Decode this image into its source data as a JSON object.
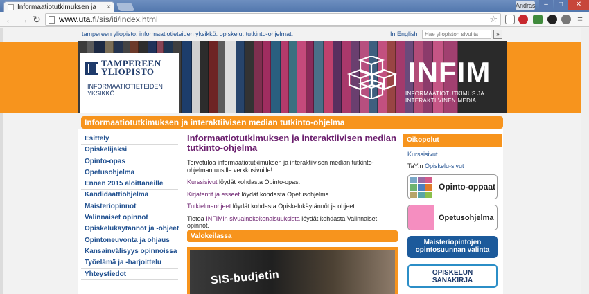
{
  "browser": {
    "tab_title": "Informaatiotutkimuksen ja",
    "tab_close": "×",
    "user_badge": "Andras",
    "win_min": "–",
    "win_max": "□",
    "win_close": "✕",
    "back": "←",
    "forward": "→",
    "reload": "↻",
    "url_host": "www.uta.fi",
    "url_path": "/sis/iti/index.html",
    "star": "☆",
    "menu": "≡"
  },
  "top": {
    "breadcrumb": "tampereen yliopisto: informaatiotieteiden yksikkö: opiskelu: tutkinto-ohjelmat:",
    "language": "In English",
    "search_placeholder": "Hae yliopiston sivuilta",
    "search_go": "»"
  },
  "banner": {
    "uni_name_1": "TAMPEREEN",
    "uni_name_2": "YLIOPISTO",
    "unit_1": "INFORMAATIOTIETEIDEN",
    "unit_2": "YKSIKKÖ",
    "infim": "INFIM",
    "infim_sub_1": "INFORMAATIOTUTKIMUS JA",
    "infim_sub_2": "INTERAKTIIVINEN MEDIA"
  },
  "program_title": "Informaatiotutkimuksen ja interaktiivisen median tutkinto-ohjelma",
  "nav": [
    "Esittely",
    "Opiskelijaksi",
    "Opinto-opas",
    "Opetusohjelma",
    "Ennen 2015 aloittaneille",
    "Kandidaattiohjelma",
    "Maisteriopinnot",
    "Valinnaiset opinnot",
    "Opiskelukäytännöt ja -ohjeet",
    "Opintoneuvonta ja ohjaus",
    "Kansainvälisyys opinnoissa",
    "Työelämä ja -harjoittelu",
    "Yhteystiedot"
  ],
  "main": {
    "heading": "Informaatiotutkimuksen ja interaktiivisen median tutkinto-ohjelma",
    "intro": "Tervetuloa informaatiotutkimuksen ja interaktiivisen median tutkinto-ohjelman uusille verkkosivuille!",
    "p1_link": "Kurssisivut",
    "p1_text": " löydät kohdasta Opinto-opas.",
    "p2_link": "Kirjatentit ja esseet",
    "p2_text": " löydät kohdasta Opetusohjelma.",
    "p3_link": "Tutkielmaohjeet",
    "p3_text": " löydät kohdasta Opiskelukäytännöt ja ohjeet.",
    "p4_pre": "Tietoa ",
    "p4_link": "INFIMin sivuainekokonaisuuksista",
    "p4_text": " löydät kohdasta Valinnaiset opinnot.",
    "spotlight": "Valokeilassa",
    "photo_text": "SIS-budjetin"
  },
  "right": {
    "header": "Oikopolut",
    "link1": "Kurssisivut",
    "link2_pre": "TaY:n ",
    "link2": "Opiskelu-sivut",
    "btn_opinto": "Opinto-oppaat",
    "btn_opetus": "Opetusohjelma",
    "btn_maisteri_1": "Maisteriopintojen",
    "btn_maisteri_2": "opintosuunnan valinta",
    "btn_sanakirja_1": "OPISKELUN",
    "btn_sanakirja_2": "SANAKIRJA"
  },
  "colors": {
    "orange": "#f7941d",
    "link_blue": "#1f4f8f",
    "purple": "#6b1f6e"
  }
}
